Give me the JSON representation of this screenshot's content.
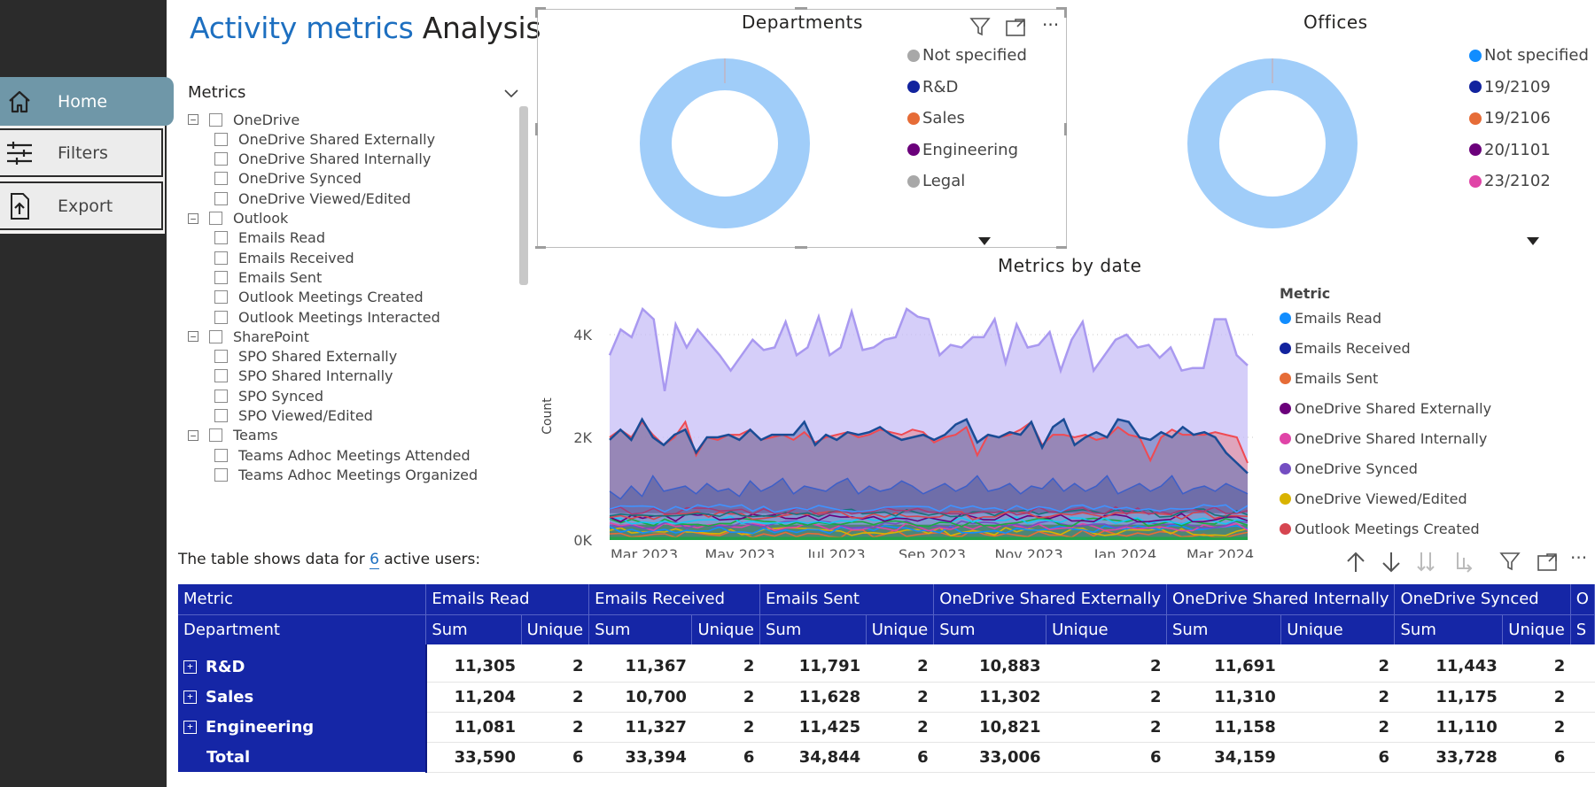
{
  "nav": {
    "items": [
      {
        "label": "Home",
        "icon": "home-icon"
      },
      {
        "label": "Filters",
        "icon": "sliders-icon"
      },
      {
        "label": "Export",
        "icon": "export-icon"
      }
    ]
  },
  "title": {
    "highlight": "Activity metrics",
    "rest": " Analysis"
  },
  "slicer": {
    "header": "Metrics",
    "groups": [
      {
        "label": "OneDrive",
        "items": [
          "OneDrive Shared Externally",
          "OneDrive Shared Internally",
          "OneDrive Synced",
          "OneDrive Viewed/Edited"
        ]
      },
      {
        "label": "Outlook",
        "items": [
          "Emails Read",
          "Emails Received",
          "Emails Sent",
          "Outlook Meetings Created",
          "Outlook Meetings Interacted"
        ]
      },
      {
        "label": "SharePoint",
        "items": [
          "SPO Shared Externally",
          "SPO Shared Internally",
          "SPO Synced",
          "SPO Viewed/Edited"
        ]
      },
      {
        "label": "Teams",
        "items": [
          "Teams Adhoc Meetings Attended",
          "Teams Adhoc Meetings Organized"
        ]
      }
    ]
  },
  "departments": {
    "title": "Departments",
    "legend": [
      {
        "label": "Not specified",
        "color": "#a8a8a8"
      },
      {
        "label": "R&D",
        "color": "#12239e"
      },
      {
        "label": "Sales",
        "color": "#e66c37"
      },
      {
        "label": "Engineering",
        "color": "#6b007b"
      },
      {
        "label": "Legal",
        "color": "#a8a8a8"
      }
    ],
    "ring_color": "#a0cdf9"
  },
  "offices": {
    "title": "Offices",
    "legend": [
      {
        "label": "Not specified",
        "color": "#118dff"
      },
      {
        "label": "19/2109",
        "color": "#12239e"
      },
      {
        "label": "19/2106",
        "color": "#e66c37"
      },
      {
        "label": "20/1101",
        "color": "#6b007b"
      },
      {
        "label": "23/2102",
        "color": "#e044a7"
      }
    ],
    "ring_color": "#a0cdf9"
  },
  "chart_data": {
    "type": "area",
    "title": "Metrics by date",
    "ylabel": "Count",
    "xlabel": "",
    "ylim": [
      0,
      5000
    ],
    "yticks": [
      "0K",
      "2K",
      "4K"
    ],
    "xticks": [
      "Mar 2023",
      "May 2023",
      "Jul 2023",
      "Sep 2023",
      "Nov 2023",
      "Jan 2024",
      "Mar 2024"
    ],
    "legend_title": "Metric",
    "legend_placement": "right",
    "series": [
      {
        "name": "Emails Read",
        "color": "#118dff"
      },
      {
        "name": "Emails Received",
        "color": "#12239e"
      },
      {
        "name": "Emails Sent",
        "color": "#e66c37"
      },
      {
        "name": "OneDrive Shared Externally",
        "color": "#6b007b"
      },
      {
        "name": "OneDrive Shared Internally",
        "color": "#e044a7"
      },
      {
        "name": "OneDrive Synced",
        "color": "#744ec2"
      },
      {
        "name": "OneDrive Viewed/Edited",
        "color": "#d9b300"
      },
      {
        "name": "Outlook Meetings Created",
        "color": "#d64550"
      }
    ],
    "top_series": [
      3600,
      4100,
      3950,
      4500,
      4300,
      2900,
      4200,
      3750,
      4100,
      3850,
      3600,
      3300,
      3600,
      3900,
      3700,
      3750,
      4250,
      3600,
      3750,
      4350,
      3600,
      3750,
      4450,
      3700,
      3750,
      3900,
      3950,
      4500,
      4350,
      4300,
      3600,
      3800,
      3750,
      3950,
      3950,
      4300,
      3450,
      4200,
      3750,
      3800,
      4050,
      3300,
      3900,
      4250,
      3300,
      3600,
      3900,
      4000,
      3750,
      3800,
      3550,
      3750,
      3300,
      3350,
      3350,
      4300,
      4300,
      3600,
      3400
    ],
    "mid_red": [
      2000,
      2150,
      2000,
      2300,
      2050,
      1850,
      2000,
      2300,
      1650,
      2000,
      1950,
      2050,
      2050,
      2150,
      1950,
      2000,
      2050,
      1950,
      2100,
      1900,
      2000,
      2050,
      2100,
      2000,
      2050,
      2150,
      2100,
      2050,
      2150,
      2100,
      1900,
      2000,
      2050,
      2200,
      1650,
      2050,
      2000,
      2050,
      2150,
      2300,
      1850,
      2050,
      2050,
      2000,
      2050,
      1950,
      2000,
      2200,
      2050,
      2000,
      1550,
      2000,
      2150,
      2050,
      2050,
      2050,
      2100,
      2050,
      2000,
      1500
    ],
    "mid_blue": [
      1950,
      2150,
      1950,
      2350,
      2000,
      1850,
      2050,
      2150,
      1700,
      2000,
      2000,
      2050,
      1950,
      2150,
      1950,
      2050,
      2050,
      2050,
      2300,
      1850,
      2050,
      1950,
      2100,
      2050,
      2100,
      2200,
      2050,
      1950,
      2000,
      2050,
      1950,
      2050,
      2250,
      2350,
      1900,
      2050,
      2000,
      2100,
      2050,
      2300,
      1800,
      2200,
      2350,
      1850,
      2000,
      2100,
      2000,
      2350,
      2300,
      2000,
      1950,
      2100,
      2000,
      2200,
      2050,
      2100,
      2000,
      1700,
      1500,
      1300
    ],
    "low_blue": [
      950,
      800,
      1050,
      850,
      1250,
      950,
      1000,
      1050,
      900,
      1100,
      950,
      1000,
      850,
      1150,
      950,
      1050,
      1200,
      900,
      1050,
      1000,
      950,
      1100,
      1200,
      900,
      1050,
      950,
      1000,
      1150,
      1050,
      900,
      1000,
      1100,
      950,
      1050,
      1250,
      950,
      1000,
      1100,
      900,
      1050,
      1000,
      1200,
      950,
      1100,
      950,
      1050,
      1250,
      900,
      1000,
      1100,
      950,
      1050,
      1250,
      900,
      1000,
      1050,
      950,
      1100,
      1000,
      900
    ]
  },
  "table": {
    "caption_prefix": "The table shows data for ",
    "active_users": "6",
    "caption_suffix": " active users:",
    "corner_top": "Metric",
    "corner_bottom": "Department",
    "metric_headers": [
      "Emails Read",
      "Emails Received",
      "Emails Sent",
      "OneDrive Shared Externally",
      "OneDrive Shared Internally",
      "OneDrive Synced",
      "O"
    ],
    "sub_headers": [
      "Sum",
      "Unique"
    ],
    "rows": [
      {
        "dept": "R&D",
        "values": [
          "11,305",
          "2",
          "11,367",
          "2",
          "11,791",
          "2",
          "10,883",
          "2",
          "11,691",
          "2",
          "11,443",
          "2"
        ]
      },
      {
        "dept": "Sales",
        "values": [
          "11,204",
          "2",
          "10,700",
          "2",
          "11,628",
          "2",
          "11,302",
          "2",
          "11,310",
          "2",
          "11,175",
          "2"
        ]
      },
      {
        "dept": "Engineering",
        "values": [
          "11,081",
          "2",
          "11,327",
          "2",
          "11,425",
          "2",
          "10,821",
          "2",
          "11,158",
          "2",
          "11,110",
          "2"
        ]
      }
    ],
    "total": {
      "label": "Total",
      "values": [
        "33,590",
        "6",
        "33,394",
        "6",
        "34,844",
        "6",
        "33,006",
        "6",
        "34,159",
        "6",
        "33,728",
        "6"
      ]
    },
    "trailing_sub": "S"
  }
}
